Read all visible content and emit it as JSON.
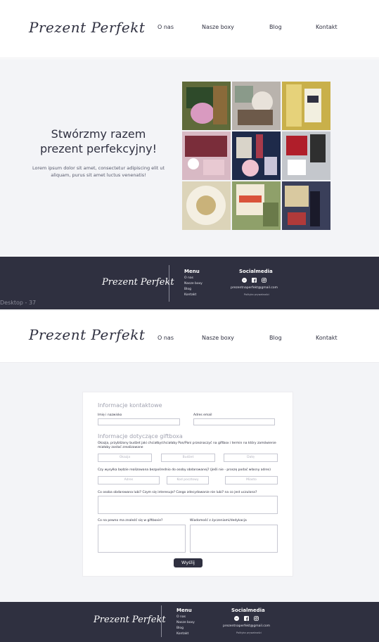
{
  "brand": {
    "logo_text": "Prezent Perfekt"
  },
  "nav": {
    "about": "O nas",
    "boxes": "Nasze boxy",
    "blog": "Blog",
    "contact": "Kontakt"
  },
  "hero": {
    "title_line1": "Stwórzmy razem",
    "title_line2": "prezent perfekcyjny!",
    "text": "Lorem ipsum dolor sit amet, consectetur adipiscing elit ut aliquam, purus sit amet luctus venenatis!"
  },
  "footer": {
    "menu_heading": "Menu",
    "menu": [
      "O nas",
      "Nasze boxy",
      "Blog",
      "Kontakt"
    ],
    "social_heading": "Socialmedia",
    "email": "prezentnaperfekt@gmail.com",
    "policy": "Polityka prywatności"
  },
  "artboard_label": "Desktop - 37",
  "form": {
    "contact_title": "Informacje kontaktowe",
    "name_label": "Imię i nazwisko",
    "email_label": "Adres email",
    "gift_title": "Informacje dotyczące giftboxa",
    "occasion_label": "Okazja, przybliżony budżet jaki chciałby/chciałaby Pan/Pani przeznaczyć na giftbox i termin na który zamówienie miałoby zostać zrealizowane",
    "occasion_ph": "Okazja",
    "budget_ph": "Budżet",
    "date_ph": "Datę",
    "delivery_label": "Czy wysyłka będzie realizowana bezpośrednio do osoby obdarowanej? (Jeśli nie - proszę podać własny adres)",
    "address_ph": "Adres",
    "postal_ph": "Kod pocztowy",
    "city_ph": "Miasto",
    "likes_label": "Co osoba obdarowana lubi? Czym się interesuje? Czego zdecydowanie nie lubi? na co jest uczulona?",
    "must_label": "Co na pewno ma znaleźć się w giftboxie?",
    "message_label": "Wiadomość z życzeniami/dedykacja",
    "submit": "Wyślij"
  },
  "colors": {
    "dark": "#2f3040",
    "light_bg": "#f3f4f7"
  }
}
